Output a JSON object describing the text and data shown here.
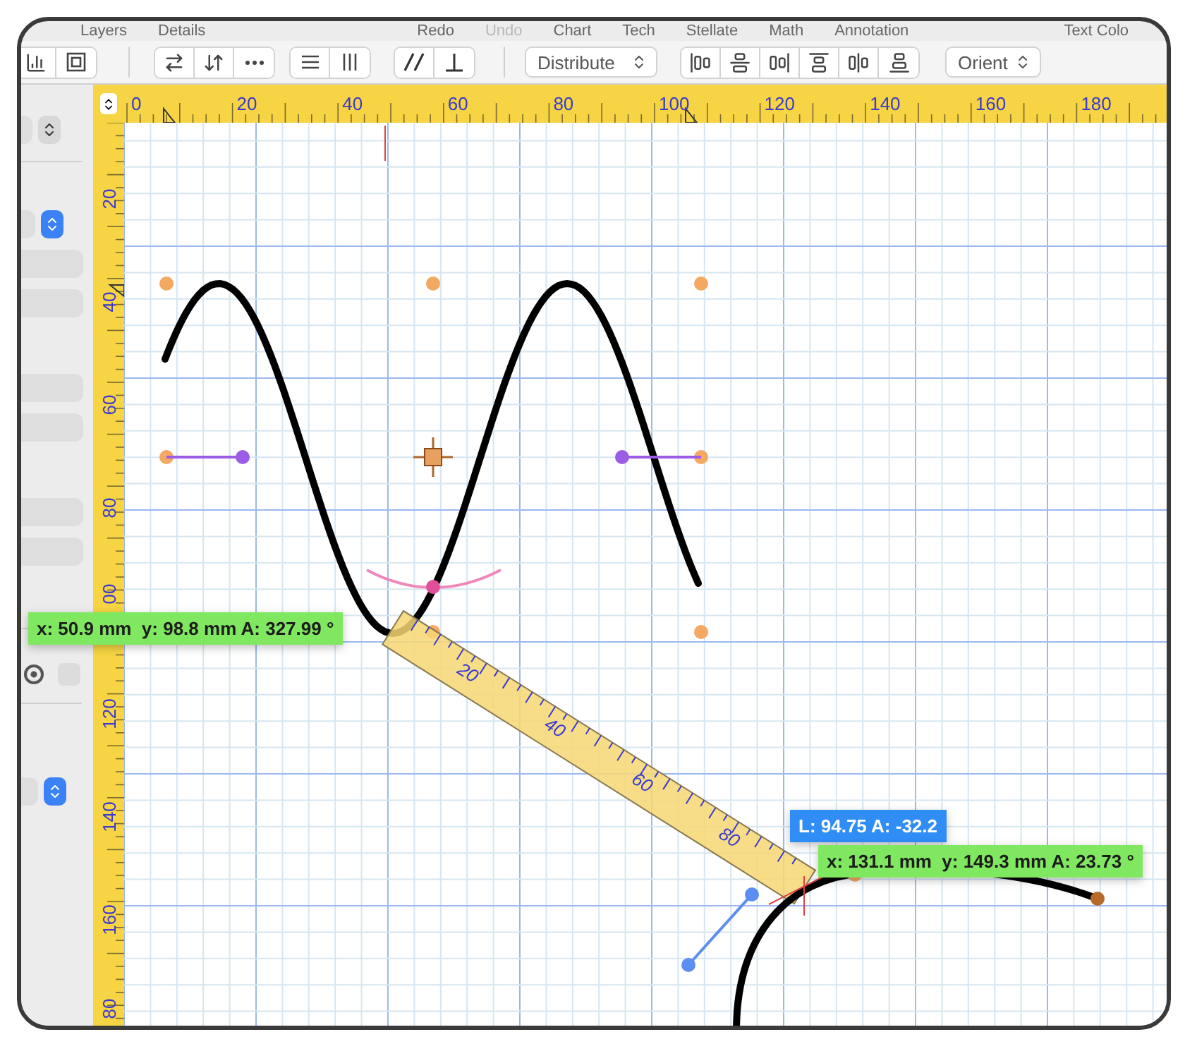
{
  "menu": [
    {
      "label": "Layers",
      "disabled": false
    },
    {
      "label": "Details",
      "disabled": false
    },
    {
      "label": "Redo",
      "disabled": false
    },
    {
      "label": "Undo",
      "disabled": true
    },
    {
      "label": "Chart",
      "disabled": false
    },
    {
      "label": "Tech",
      "disabled": false
    },
    {
      "label": "Stellate",
      "disabled": false
    },
    {
      "label": "Math",
      "disabled": false
    },
    {
      "label": "Annotation",
      "disabled": false
    },
    {
      "label": "Text Colo",
      "disabled": false
    }
  ],
  "toolbar": {
    "distribute": "Distribute",
    "orient": "Orient"
  },
  "sidebar": {
    "option": {
      "selected": true
    },
    "checkbox": {
      "checked": false
    }
  },
  "rulers": {
    "x_labels": [
      "0",
      "20",
      "40",
      "60",
      "80",
      "100",
      "120",
      "140",
      "160",
      "180"
    ],
    "y_labels": [
      "20",
      "40",
      "60",
      "80",
      "00",
      "120",
      "140",
      "160",
      "80"
    ]
  },
  "measure_tape": {
    "labels": [
      "20",
      "40",
      "60",
      "80"
    ]
  },
  "readouts": [
    {
      "kind": "point",
      "text": "x: 50.9 mm  y: 98.8 mm A: 327.99 °"
    },
    {
      "kind": "length",
      "text": "L: 94.75 A: -32.2"
    },
    {
      "kind": "point",
      "text": "x: 131.1 mm  y: 149.3 mm A: 23.73 °"
    }
  ]
}
